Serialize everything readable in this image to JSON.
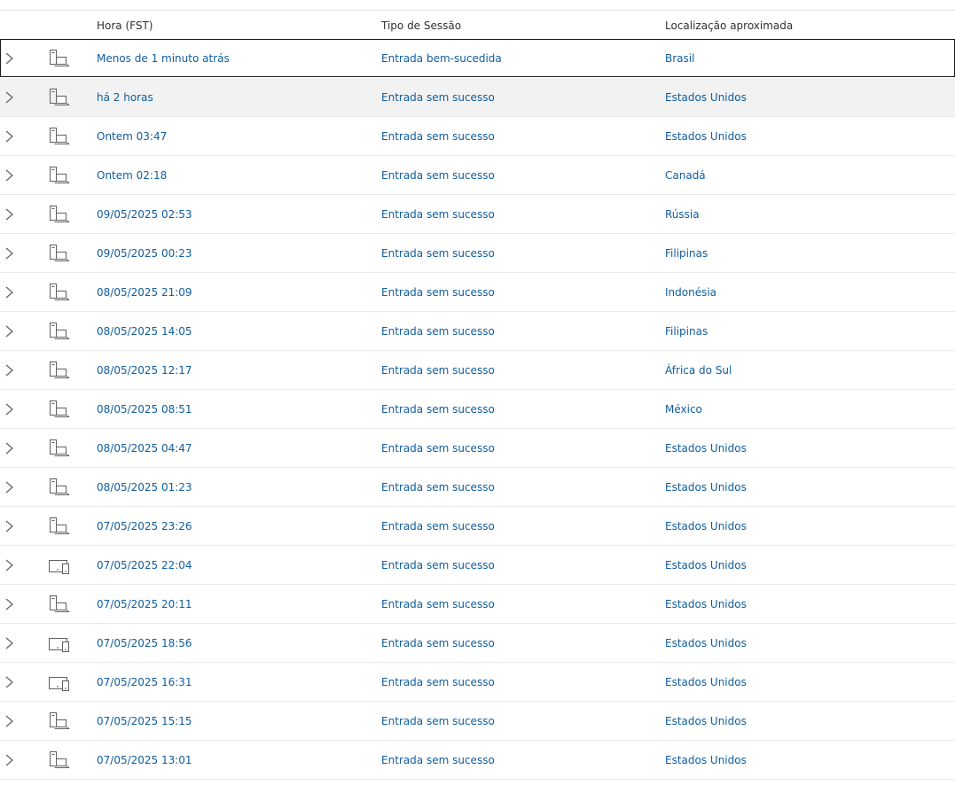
{
  "columns": {
    "time": "Hora (FST)",
    "type": "Tipo de Sessão",
    "location": "Localização aproximada"
  },
  "rows": [
    {
      "time": "Menos de 1 minuto atrás",
      "type": "Entrada bem-sucedida",
      "location": "Brasil",
      "device": "desktop-laptop-icon",
      "state": "selected"
    },
    {
      "time": "há 2 horas",
      "type": "Entrada sem sucesso",
      "location": "Estados Unidos",
      "device": "desktop-laptop-icon",
      "state": "hovered"
    },
    {
      "time": "Ontem 03:47",
      "type": "Entrada sem sucesso",
      "location": "Estados Unidos",
      "device": "desktop-laptop-icon",
      "state": ""
    },
    {
      "time": "Ontem 02:18",
      "type": "Entrada sem sucesso",
      "location": "Canadá",
      "device": "desktop-laptop-icon",
      "state": ""
    },
    {
      "time": "09/05/2025 02:53",
      "type": "Entrada sem sucesso",
      "location": "Rússia",
      "device": "desktop-laptop-icon",
      "state": ""
    },
    {
      "time": "09/05/2025 00:23",
      "type": "Entrada sem sucesso",
      "location": "Filipinas",
      "device": "desktop-laptop-icon",
      "state": ""
    },
    {
      "time": "08/05/2025 21:09",
      "type": "Entrada sem sucesso",
      "location": "Indonésia",
      "device": "desktop-laptop-icon",
      "state": ""
    },
    {
      "time": "08/05/2025 14:05",
      "type": "Entrada sem sucesso",
      "location": "Filipinas",
      "device": "desktop-laptop-icon",
      "state": ""
    },
    {
      "time": "08/05/2025 12:17",
      "type": "Entrada sem sucesso",
      "location": "África do Sul",
      "device": "desktop-laptop-icon",
      "state": ""
    },
    {
      "time": "08/05/2025 08:51",
      "type": "Entrada sem sucesso",
      "location": "México",
      "device": "desktop-laptop-icon",
      "state": ""
    },
    {
      "time": "08/05/2025 04:47",
      "type": "Entrada sem sucesso",
      "location": "Estados Unidos",
      "device": "desktop-laptop-icon",
      "state": ""
    },
    {
      "time": "08/05/2025 01:23",
      "type": "Entrada sem sucesso",
      "location": "Estados Unidos",
      "device": "desktop-laptop-icon",
      "state": ""
    },
    {
      "time": "07/05/2025 23:26",
      "type": "Entrada sem sucesso",
      "location": "Estados Unidos",
      "device": "desktop-laptop-icon",
      "state": ""
    },
    {
      "time": "07/05/2025 22:04",
      "type": "Entrada sem sucesso",
      "location": "Estados Unidos",
      "device": "tablet-phone-icon",
      "state": ""
    },
    {
      "time": "07/05/2025 20:11",
      "type": "Entrada sem sucesso",
      "location": "Estados Unidos",
      "device": "desktop-laptop-icon",
      "state": ""
    },
    {
      "time": "07/05/2025 18:56",
      "type": "Entrada sem sucesso",
      "location": "Estados Unidos",
      "device": "tablet-phone-icon",
      "state": ""
    },
    {
      "time": "07/05/2025 16:31",
      "type": "Entrada sem sucesso",
      "location": "Estados Unidos",
      "device": "tablet-phone-icon",
      "state": ""
    },
    {
      "time": "07/05/2025 15:15",
      "type": "Entrada sem sucesso",
      "location": "Estados Unidos",
      "device": "desktop-laptop-icon",
      "state": ""
    },
    {
      "time": "07/05/2025 13:01",
      "type": "Entrada sem sucesso",
      "location": "Estados Unidos",
      "device": "desktop-laptop-icon",
      "state": ""
    }
  ],
  "colors": {
    "link": "#0f5c9e",
    "header_text": "#323130",
    "icon": "#5f5f5f",
    "row_divider": "#e8e8e8",
    "hover_bg": "#f2f2f2",
    "selected_border": "#1b1b1b"
  }
}
